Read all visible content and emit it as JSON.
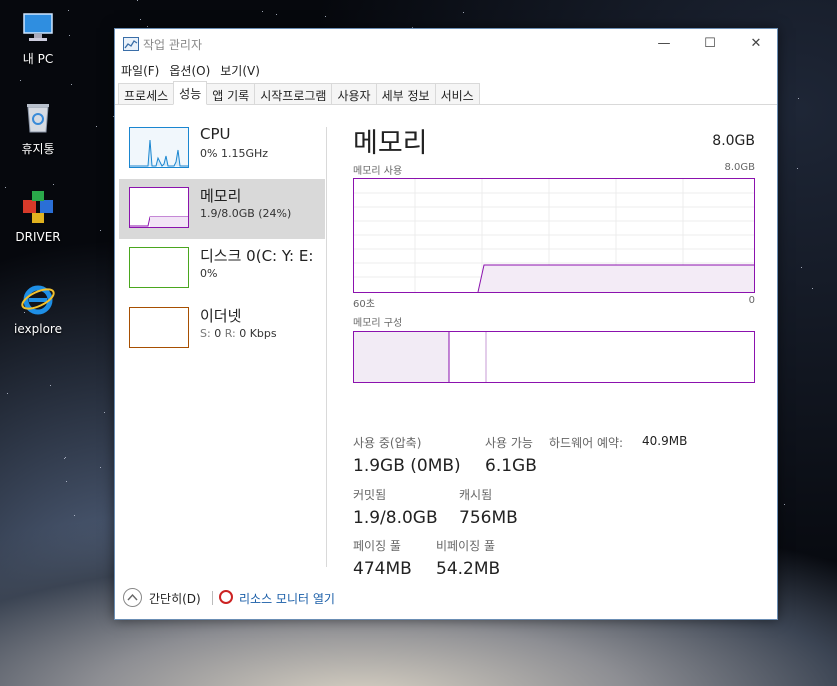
{
  "desktop": {
    "icons": [
      {
        "label": "내 PC",
        "icon": "computer-icon"
      },
      {
        "label": "휴지통",
        "icon": "recycle-bin-icon"
      },
      {
        "label": "DRIVER",
        "icon": "driver-app-icon"
      },
      {
        "label": "iexplore",
        "icon": "internet-explorer-icon"
      }
    ]
  },
  "window": {
    "title": "작업 관리자",
    "controls": {
      "minimize": "—",
      "maximize": "☐",
      "close": "✕"
    },
    "menu": [
      "파일(F)",
      "옵션(O)",
      "보기(V)"
    ],
    "tabs": [
      "프로세스",
      "성능",
      "앱 기록",
      "시작프로그램",
      "사용자",
      "세부 정보",
      "서비스"
    ],
    "active_tab": "성능"
  },
  "sidebar": {
    "items": [
      {
        "name": "CPU",
        "sub": "0% 1.15GHz",
        "color": "#1a86d0"
      },
      {
        "name": "메모리",
        "sub": "1.9/8.0GB (24%)",
        "color": "#8b12ae"
      },
      {
        "name": "디스크 0(C: Y: E:",
        "sub": "0%",
        "color": "#4aa71e"
      },
      {
        "name": "이더넷",
        "sub_s_label": "S:",
        "sub_s_val": "0",
        "sub_r_label": "R:",
        "sub_r_val": "0 Kbps",
        "color": "#a74f01"
      }
    ]
  },
  "memory": {
    "title": "메모리",
    "capacity": "8.0GB",
    "usage_label": "메모리 사용",
    "usage_max": "8.0GB",
    "axis_left": "60초",
    "axis_right": "0",
    "composition_label": "메모리 구성",
    "stats": {
      "in_use_label": "사용 중(압축)",
      "in_use_value": "1.9GB (0MB)",
      "available_label": "사용 가능",
      "available_value": "6.1GB",
      "hw_reserved_label": "하드웨어 예약:",
      "hw_reserved_value": "40.9MB",
      "committed_label": "커밋됨",
      "committed_value": "1.9/8.0GB",
      "cached_label": "캐시됨",
      "cached_value": "756MB",
      "paged_label": "페이징 풀",
      "paged_value": "474MB",
      "nonpaged_label": "비페이징 풀",
      "nonpaged_value": "54.2MB"
    },
    "usage_fraction": 0.24
  },
  "footer": {
    "fewer_details": "간단히(D)",
    "resource_monitor": "리소스 모니터 열기"
  }
}
